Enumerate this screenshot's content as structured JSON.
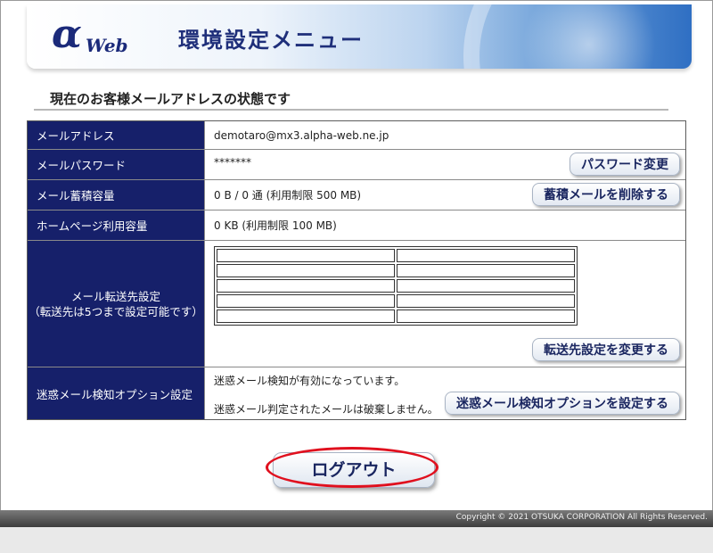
{
  "header": {
    "logo_alpha": "α",
    "logo_web": "Web",
    "title": "環境設定メニュー"
  },
  "section": {
    "title": "現在のお客様メールアドレスの状態です"
  },
  "rows": {
    "email": {
      "label": "メールアドレス",
      "value": "demotaro@mx3.alpha-web.ne.jp"
    },
    "password": {
      "label": "メールパスワード",
      "value": "*******",
      "button": "パスワード変更"
    },
    "storage": {
      "label": "メール蓄積容量",
      "value": "0 B / 0 通 (利用制限 500 MB)",
      "button": "蓄積メールを削除する"
    },
    "homepage": {
      "label": "ホームページ利用容量",
      "value": "0 KB (利用制限 100 MB)"
    },
    "forward": {
      "label_line1": "メール転送先設定",
      "label_line2": "（転送先は5つまで設定可能です）",
      "button": "転送先設定を変更する"
    },
    "spam": {
      "label": "迷惑メール検知オプション設定",
      "status1": "迷惑メール検知が有効になっています。",
      "status2": "迷惑メール判定されたメールは破棄しません。",
      "button": "迷惑メール検知オプションを設定する"
    }
  },
  "logout": {
    "label": "ログアウト"
  },
  "footer": {
    "copyright": "Copyright © 2021 OTSUKA CORPORATION All Rights Reserved."
  },
  "colors": {
    "header_cell": "#16206a",
    "highlight_ring": "#e0101e",
    "button_text": "#1a2660"
  }
}
